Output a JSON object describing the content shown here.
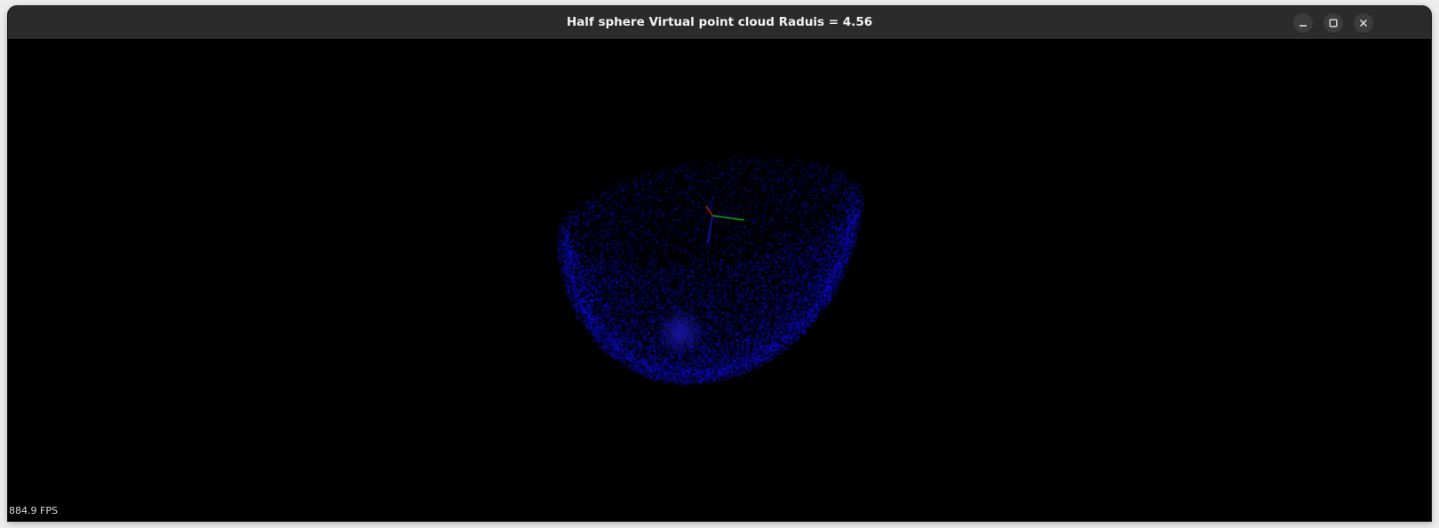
{
  "window": {
    "title": "Half sphere Virtual point cloud Raduis = 4.56"
  },
  "controls": {
    "minimize_icon": "minimize-icon",
    "maximize_icon": "maximize-icon",
    "close_icon": "close-icon"
  },
  "viewport": {
    "background_color": "#000000",
    "point_color": "#1010ff",
    "axis_colors": {
      "x": "#ff2020",
      "y": "#20ff20",
      "z": "#2020ff"
    },
    "fps_label": "884.9 FPS"
  }
}
